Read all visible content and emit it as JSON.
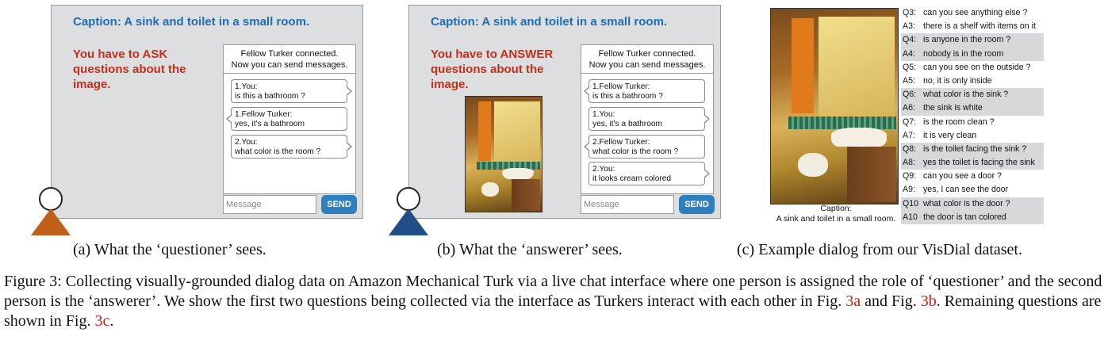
{
  "panel_a": {
    "caption": "Caption: A sink and toilet in a small room.",
    "instruction": "You have to ASK questions about the image.",
    "chat_header_1": "Fellow Turker connected.",
    "chat_header_2": "Now you can send messages.",
    "messages": [
      {
        "sender": "1.You:",
        "text": "is this a bathroom ?"
      },
      {
        "sender": "1.Fellow Turker:",
        "text": "yes, it's a bathroom"
      },
      {
        "sender": "2.You:",
        "text": "what color is the room ?"
      }
    ],
    "input_placeholder": "Message",
    "send_label": "SEND",
    "avatar_color": "#c0601a"
  },
  "panel_b": {
    "caption": "Caption: A sink and toilet in a small room.",
    "instruction": "You have to ANSWER questions about the image.",
    "chat_header_1": "Fellow Turker connected.",
    "chat_header_2": "Now you can send messages.",
    "messages": [
      {
        "sender": "1.Fellow Turker:",
        "text": "is this a bathroom ?"
      },
      {
        "sender": "1.You:",
        "text": "yes, it's a bathroom"
      },
      {
        "sender": "2.Fellow Turker:",
        "text": "what color is the room ?"
      },
      {
        "sender": "2.You:",
        "text": "it looks cream colored"
      }
    ],
    "input_placeholder": "Message",
    "send_label": "SEND",
    "avatar_color": "#1f4f86"
  },
  "panel_c": {
    "photo_caption_1": "Caption:",
    "photo_caption_2": "A sink and toilet in a small room.",
    "dialog": [
      {
        "label": "Q3:",
        "text": "can you see anything else ?"
      },
      {
        "label": "A3:",
        "text": "there is a shelf with items on it"
      },
      {
        "label": "Q4:",
        "text": "is anyone in the room ?"
      },
      {
        "label": "A4:",
        "text": "nobody is in the room"
      },
      {
        "label": "Q5:",
        "text": "can you see on the outside ?"
      },
      {
        "label": "A5:",
        "text": "no, it is only inside"
      },
      {
        "label": "Q6:",
        "text": "what color is the sink ?"
      },
      {
        "label": "A6:",
        "text": "the sink is white"
      },
      {
        "label": "Q7:",
        "text": "is the room clean ?"
      },
      {
        "label": "A7:",
        "text": "it is very clean"
      },
      {
        "label": "Q8:",
        "text": "is the toilet facing the sink ?"
      },
      {
        "label": "A8:",
        "text": "yes the toilet is facing the sink"
      },
      {
        "label": "Q9:",
        "text": "can you see a door ?"
      },
      {
        "label": "A9:",
        "text": "yes, I can see the door"
      },
      {
        "label": "Q10",
        "text": "what color is the door ?"
      },
      {
        "label": "A10",
        "text": "the door is tan colored"
      }
    ]
  },
  "sublabels": {
    "a": "(a) What the ‘questioner’ sees.",
    "b": "(b) What the ‘answerer’ sees.",
    "c": "(c) Example dialog from our VisDial dataset."
  },
  "figure_caption": {
    "part1": "Figure 3: Collecting visually-grounded dialog data on Amazon Mechanical Turk via a live chat interface where one person is assigned the role of ‘questioner’ and the second person is the ‘answerer’. We show the first two questions being collected via the interface as Turkers interact with each other in Fig. ",
    "ref1": "3a",
    "part2": " and Fig. ",
    "ref2": "3b",
    "part3": ". Remaining questions are shown in Fig. ",
    "ref3": "3c",
    "part4": "."
  },
  "colors": {
    "caption_blue": "#1f6db5",
    "instruction_red": "#c0301d",
    "send_button": "#2f7fbf",
    "ref_red": "#c0201a"
  }
}
